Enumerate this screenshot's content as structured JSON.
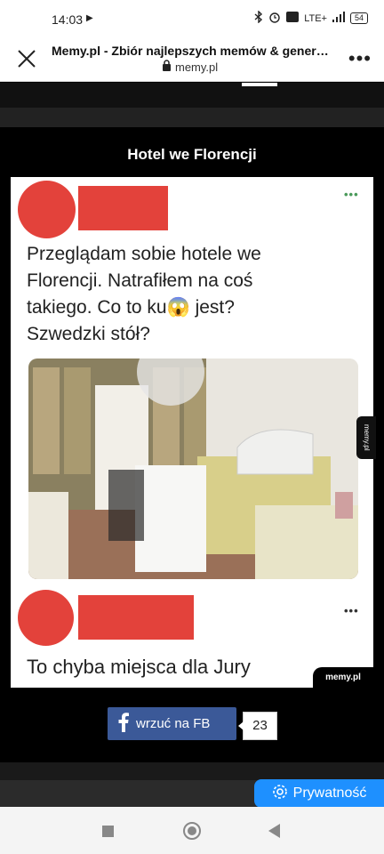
{
  "status": {
    "time": "14:03",
    "play": "▶",
    "network": "LTE+",
    "battery": "54"
  },
  "urlbar": {
    "title": "Memy.pl - Zbiór najlepszych memów & generat…",
    "domain": "memy.pl"
  },
  "post": {
    "title": "Hotel we Florencji",
    "meme_text_1": [
      "Przeglądam sobie hotele we",
      "Florencji. Natrafiłem na coś",
      "takiego. Co to ku😱 jest?",
      "Szwedzki stół?"
    ],
    "meme_text_2": "To chyba miejsca dla Jury",
    "dots": "•••",
    "watermark_side": "memy.pl",
    "watermark_bottom": "memy.pl"
  },
  "share": {
    "fb_label": "wrzuć na FB",
    "count": "23"
  },
  "privacy": {
    "label": "Prywatność"
  },
  "colors": {
    "fb": "#3b5998",
    "privacy": "#1e90ff",
    "meme_red": "#e3423b"
  }
}
